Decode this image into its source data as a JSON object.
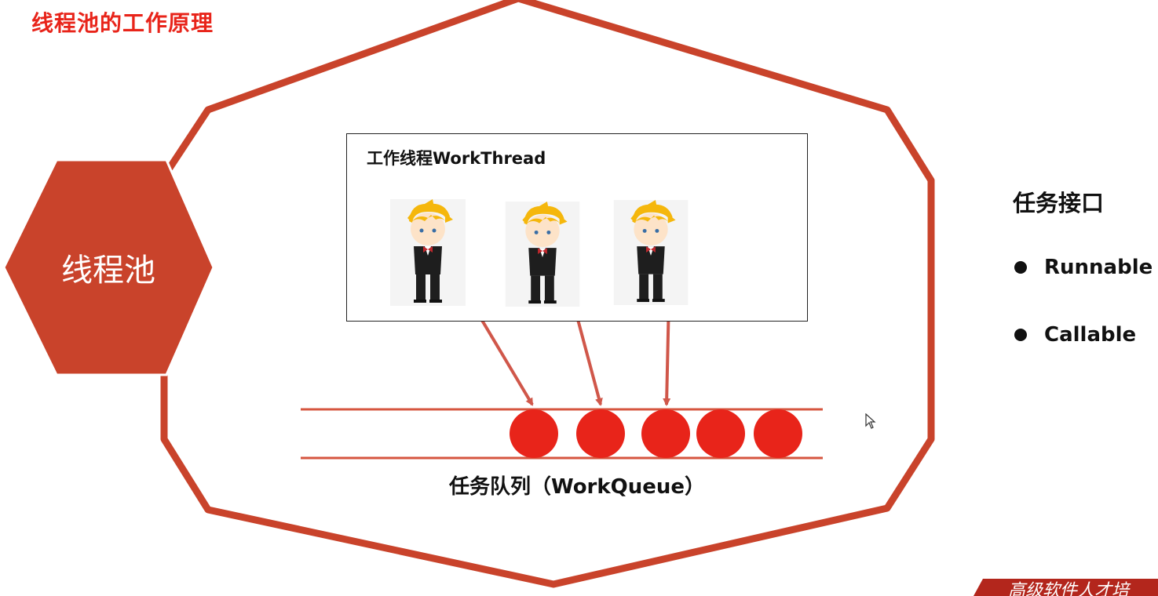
{
  "slide_title": "线程池的工作原理",
  "pool": {
    "label": "线程池",
    "border_color": "#c9432b",
    "fill_color": "#c9432b"
  },
  "workers": {
    "title": "工作线程WorkThread",
    "count": 3,
    "icon": "cartoon-waiter-icon"
  },
  "queue": {
    "label": "任务队列（WorkQueue）",
    "task_count": 5,
    "task_color": "#e8241a",
    "line_color": "#d6553f"
  },
  "interfaces": {
    "title": "任务接口",
    "items": [
      "Runnable",
      "Callable"
    ]
  },
  "banner": {
    "text": "高级软件人才培"
  },
  "colors": {
    "accent_red": "#e8241a",
    "arrow": "#d0574a"
  }
}
